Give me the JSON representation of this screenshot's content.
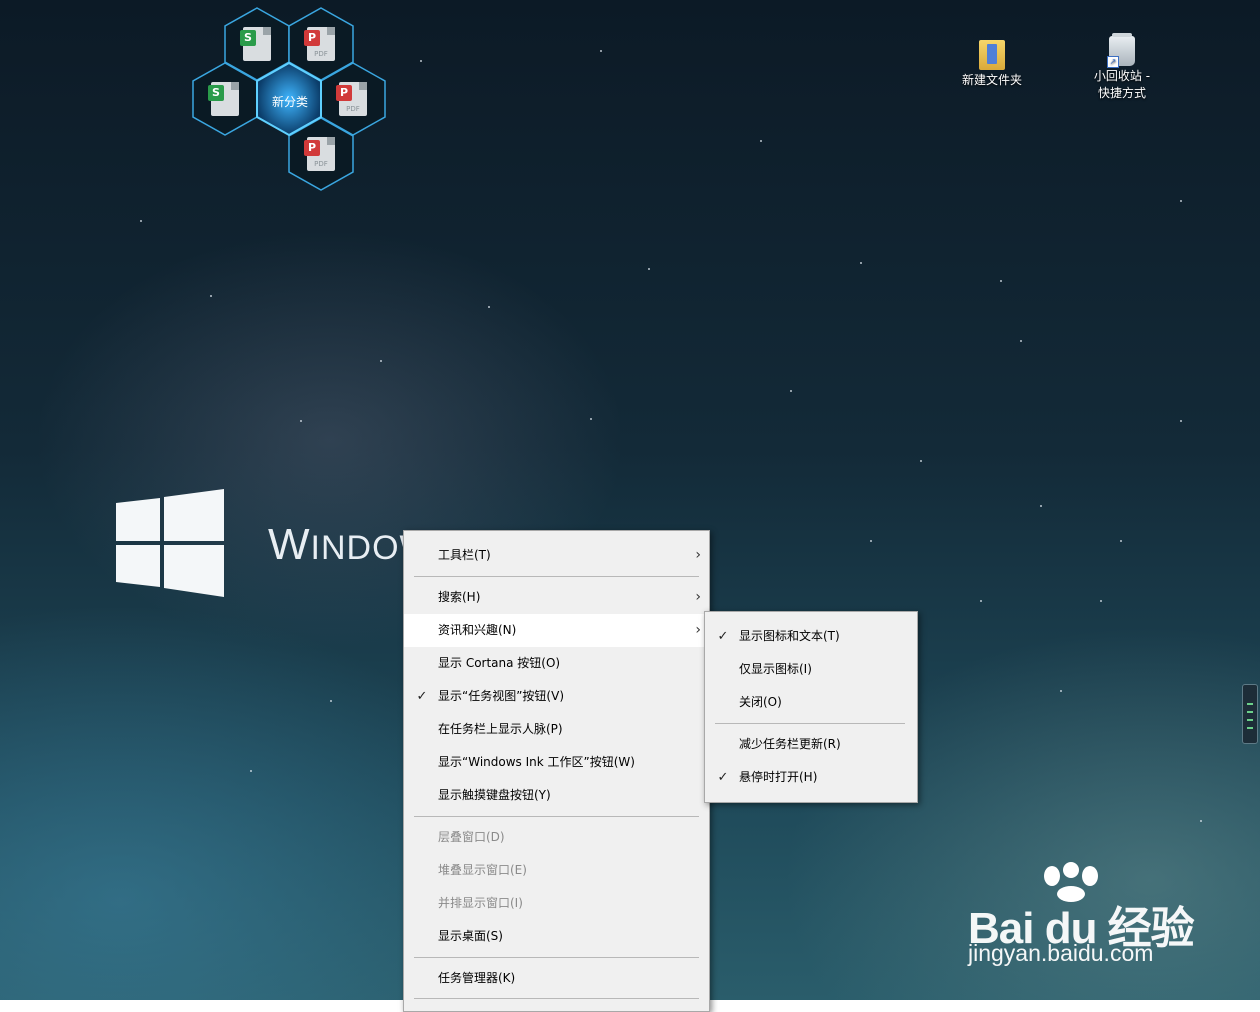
{
  "hex_widget": {
    "center_label": "新分类",
    "files": [
      {
        "type": "S",
        "kind": "spreadsheet"
      },
      {
        "type": "PDF",
        "kind": "pdf"
      },
      {
        "type": "S",
        "kind": "spreadsheet"
      },
      {
        "type": "PDF",
        "kind": "pdf"
      },
      {
        "type": "PDF",
        "kind": "pdf"
      }
    ],
    "pdf_tag": "PDF",
    "s_tag": "S"
  },
  "desktop_icons": [
    {
      "label": "新建文件夹",
      "icon": "folder-icon"
    },
    {
      "label_line1": "小回收站 -",
      "label_line2": "快捷方式",
      "icon": "recycle-bin-shortcut-icon"
    }
  ],
  "windows_brand": {
    "text_big": "W",
    "text_small": "INDOW"
  },
  "taskbar_menu": {
    "items": [
      {
        "label": "工具栏(T)",
        "submenu": true,
        "checked": false,
        "disabled": false
      },
      {
        "label": "搜索(H)",
        "submenu": true,
        "checked": false,
        "disabled": false
      },
      {
        "label": "资讯和兴趣(N)",
        "submenu": true,
        "checked": false,
        "disabled": false,
        "highlighted": true
      },
      {
        "label": "显示 Cortana 按钮(O)",
        "submenu": false,
        "checked": false,
        "disabled": false
      },
      {
        "label": "显示“任务视图”按钮(V)",
        "submenu": false,
        "checked": true,
        "disabled": false
      },
      {
        "label": "在任务栏上显示人脉(P)",
        "submenu": false,
        "checked": false,
        "disabled": false
      },
      {
        "label": "显示“Windows Ink 工作区”按钮(W)",
        "submenu": false,
        "checked": false,
        "disabled": false
      },
      {
        "label": "显示触摸键盘按钮(Y)",
        "submenu": false,
        "checked": false,
        "disabled": false
      },
      {
        "label": "层叠窗口(D)",
        "submenu": false,
        "checked": false,
        "disabled": true
      },
      {
        "label": "堆叠显示窗口(E)",
        "submenu": false,
        "checked": false,
        "disabled": true
      },
      {
        "label": "并排显示窗口(I)",
        "submenu": false,
        "checked": false,
        "disabled": true
      },
      {
        "label": "显示桌面(S)",
        "submenu": false,
        "checked": false,
        "disabled": false
      },
      {
        "label": "任务管理器(K)",
        "submenu": false,
        "checked": false,
        "disabled": false
      }
    ],
    "check_glyph": "✓",
    "arrow_glyph": "›"
  },
  "news_submenu": {
    "items": [
      {
        "label": "显示图标和文本(T)",
        "checked": true
      },
      {
        "label": "仅显示图标(I)",
        "checked": false
      },
      {
        "label": "关闭(O)",
        "checked": false
      },
      {
        "label": "减少任务栏更新(R)",
        "checked": false
      },
      {
        "label": "悬停时打开(H)",
        "checked": true
      }
    ]
  },
  "watermark": {
    "brand": "Bai du 经验",
    "url": "jingyan.baidu.com"
  },
  "colors": {
    "menu_bg": "#f0f0f0",
    "hex_glow": "#1e8fd6",
    "highlight": "#ffffff"
  }
}
